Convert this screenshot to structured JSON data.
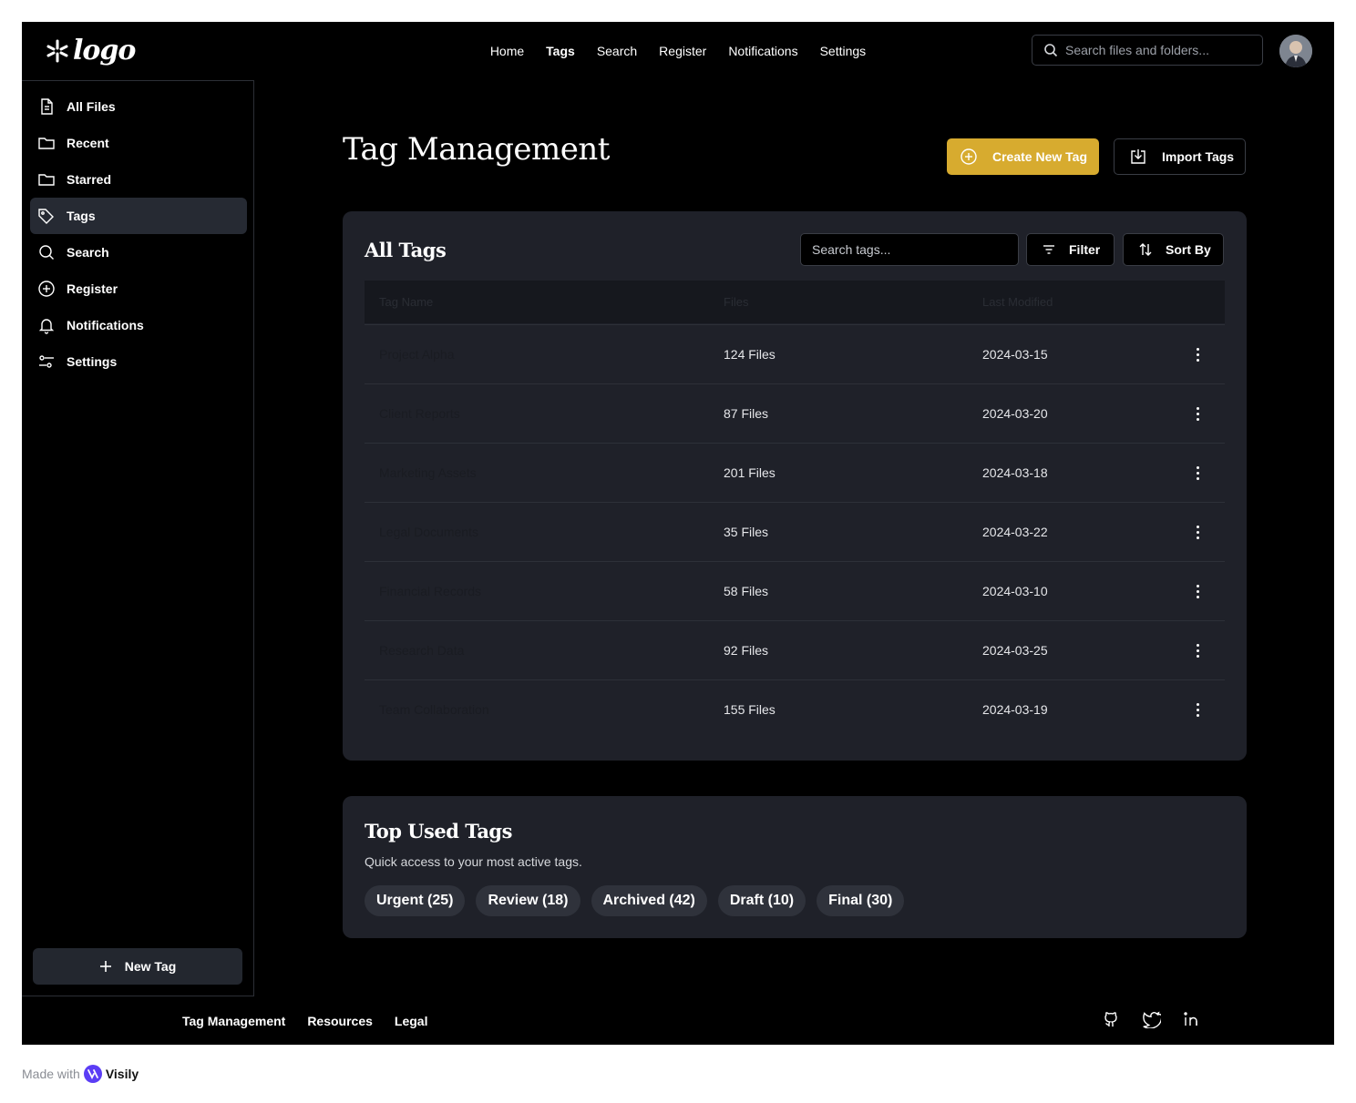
{
  "logo": {
    "text": "logo"
  },
  "topnav": {
    "items": [
      "Home",
      "Tags",
      "Search",
      "Register",
      "Notifications",
      "Settings"
    ],
    "active": "Tags"
  },
  "header_search": {
    "placeholder": "Search files and folders..."
  },
  "sidebar": {
    "items": [
      {
        "label": "All Files",
        "icon": "file-icon"
      },
      {
        "label": "Recent",
        "icon": "folder-icon"
      },
      {
        "label": "Starred",
        "icon": "folder-icon"
      },
      {
        "label": "Tags",
        "icon": "tag-icon",
        "active": true
      },
      {
        "label": "Search",
        "icon": "search-icon"
      },
      {
        "label": "Register",
        "icon": "plus-circle-icon"
      },
      {
        "label": "Notifications",
        "icon": "bell-icon"
      },
      {
        "label": "Settings",
        "icon": "sliders-icon"
      }
    ],
    "new_tag_label": "New Tag"
  },
  "page": {
    "title": "Tag Management",
    "create_label": "Create New Tag",
    "import_label": "Import Tags"
  },
  "all_tags": {
    "title": "All Tags",
    "search_placeholder": "Search tags...",
    "filter_label": "Filter",
    "sort_label": "Sort By",
    "columns": [
      "Tag Name",
      "Files",
      "Last Modified"
    ],
    "rows": [
      {
        "name": "Project Alpha",
        "files": "124 Files",
        "date": "2024-03-15"
      },
      {
        "name": "Client Reports",
        "files": "87 Files",
        "date": "2024-03-20"
      },
      {
        "name": "Marketing Assets",
        "files": "201 Files",
        "date": "2024-03-18"
      },
      {
        "name": "Legal Documents",
        "files": "35 Files",
        "date": "2024-03-22"
      },
      {
        "name": "Financial Records",
        "files": "58 Files",
        "date": "2024-03-10"
      },
      {
        "name": "Research Data",
        "files": "92 Files",
        "date": "2024-03-25"
      },
      {
        "name": "Team Collaboration",
        "files": "155 Files",
        "date": "2024-03-19"
      }
    ]
  },
  "top_tags": {
    "title": "Top Used Tags",
    "subtitle": "Quick access to your most active tags.",
    "chips": [
      "Urgent (25)",
      "Review (18)",
      "Archived (42)",
      "Draft (10)",
      "Final (30)"
    ]
  },
  "footer": {
    "links": [
      "Tag Management",
      "Resources",
      "Legal"
    ],
    "socials": [
      "github-icon",
      "twitter-icon",
      "linkedin-icon"
    ]
  },
  "made_with": {
    "prefix": "Made with",
    "brand": "Visily"
  },
  "colors": {
    "accent": "#d7ab2f",
    "background": "#000000",
    "card": "#1f2129"
  }
}
